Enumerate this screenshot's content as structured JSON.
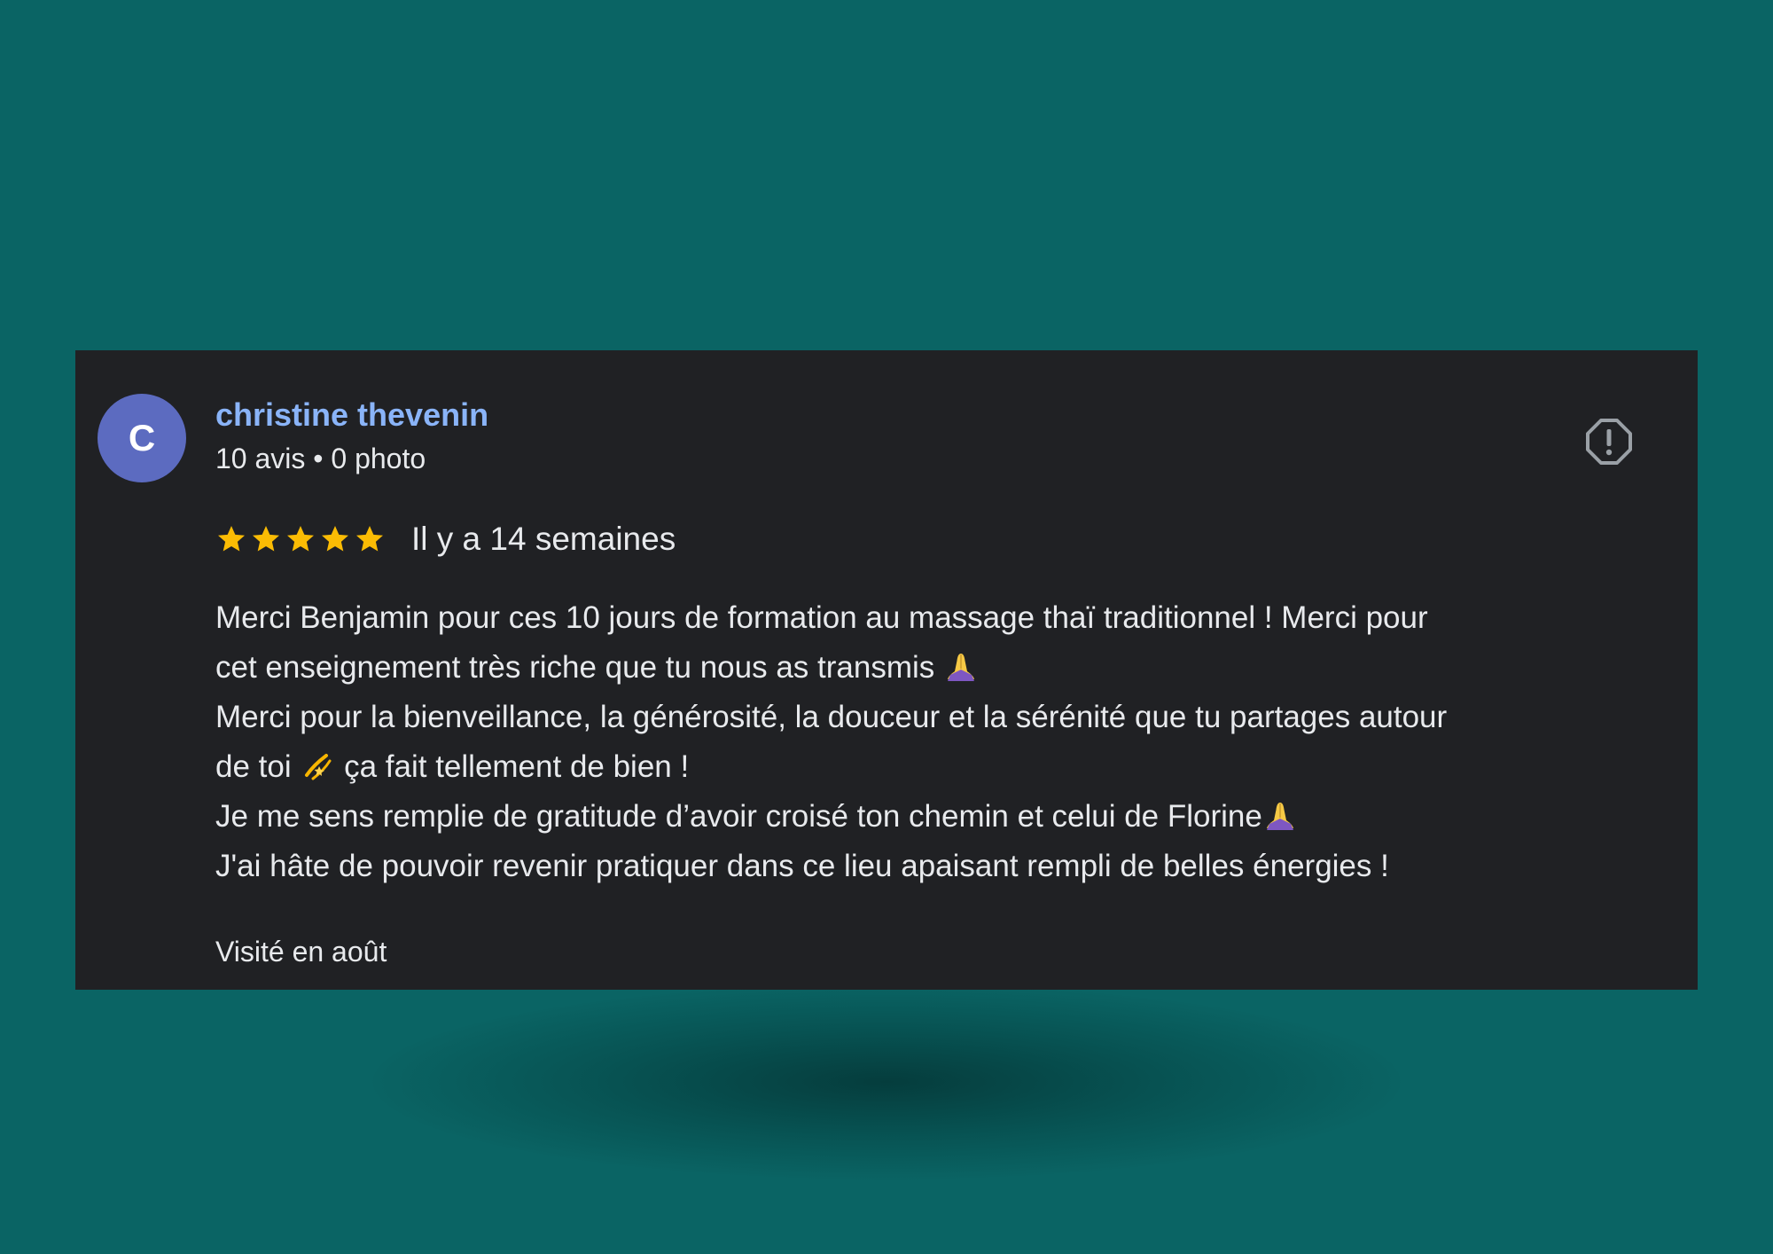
{
  "review": {
    "author_initial": "C",
    "author_name": "christine thevenin",
    "author_meta": "10 avis • 0 photo",
    "rating": 5,
    "rating_max": 5,
    "date": "Il y a 14 semaines",
    "lines": {
      "l1": "Merci Benjamin pour ces 10 jours de formation au massage thaï traditionnel ! Merci pour",
      "l2": "cet enseignement très riche que tu nous as transmis",
      "l3": "Merci pour la bienveillance, la générosité, la douceur et la sérénité que tu partages autour",
      "l4a": "de toi",
      "l4b": "ça fait tellement de bien !",
      "l5": "Je me sens remplie de gratitude d’avoir croisé ton chemin et celui de Florine",
      "l6": "J'ai hâte de pouvoir revenir pratiquer dans ce lieu apaisant rempli de belles énergies !"
    },
    "visit": "Visité en août"
  },
  "icons": {
    "report": "report-flag-icon",
    "star": "star-icon",
    "pray": "folded-hands-emoji",
    "dizzy": "dizzy-emoji"
  },
  "colors": {
    "page_background": "#0a6464",
    "card_background": "#202124",
    "name_link": "#8ab4f8",
    "avatar": "#5c6bc0",
    "star": "#fbbc04",
    "text": "#e8eaed"
  }
}
